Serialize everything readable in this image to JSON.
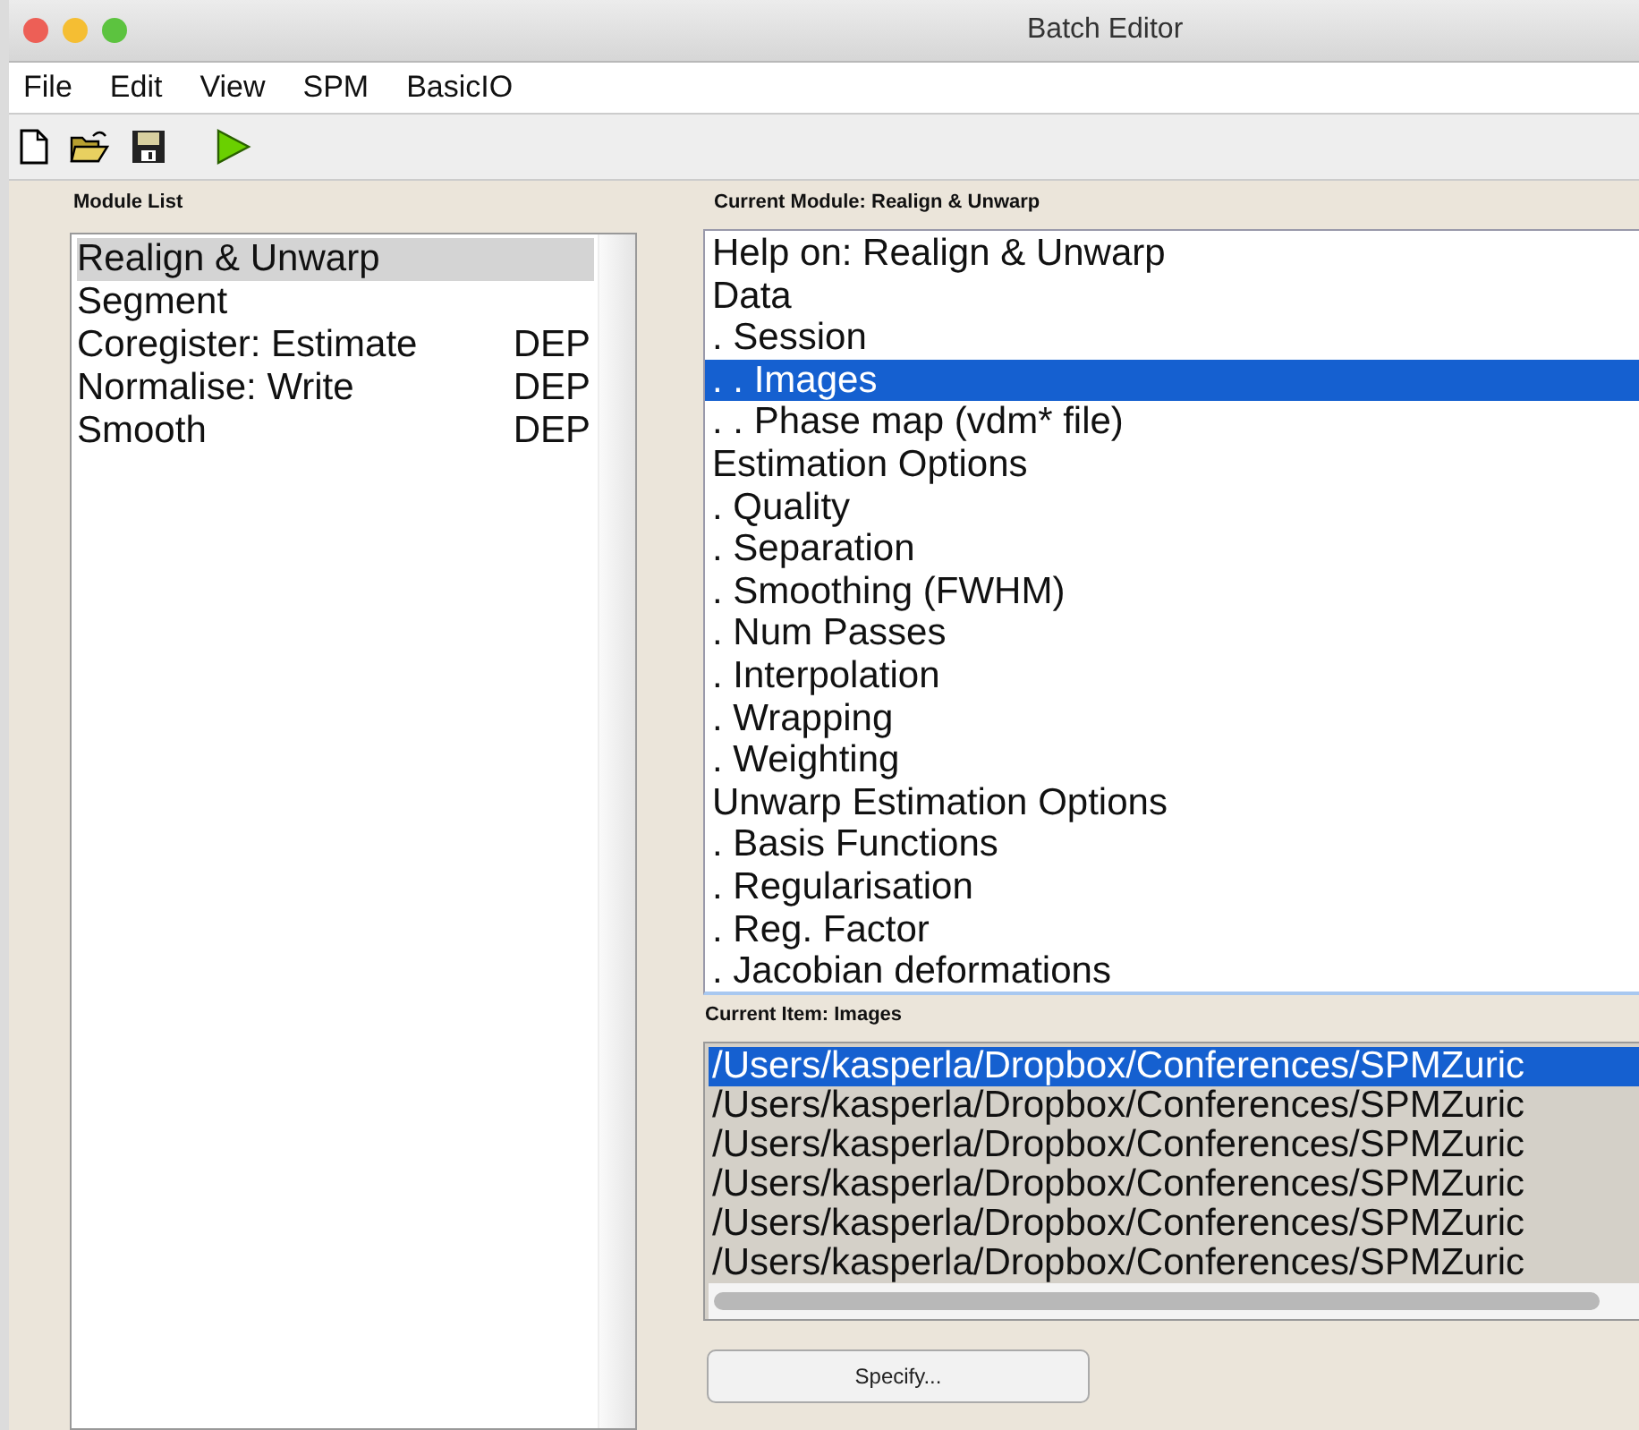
{
  "window": {
    "title": "Batch Editor"
  },
  "menu": [
    "File",
    "Edit",
    "View",
    "SPM",
    "BasicIO"
  ],
  "module_list": {
    "label": "Module List",
    "items": [
      {
        "name": "Realign & Unwarp",
        "selected": true
      },
      {
        "name": "Segment",
        "selected": false
      },
      {
        "name": "Coregister: Estimate",
        "tag": "DEP",
        "selected": false
      },
      {
        "name": "Normalise: Write",
        "tag": "DEP",
        "selected": false
      },
      {
        "name": "Smooth",
        "tag": "DEP",
        "selected": false
      }
    ]
  },
  "current_module": {
    "label": "Current Module: Realign & Unwarp",
    "items": [
      {
        "text": "Help on: Realign & Unwarp",
        "selected": false
      },
      {
        "text": "Data",
        "selected": false
      },
      {
        "text": ". Session",
        "selected": false
      },
      {
        "text": ". . Images",
        "selected": true
      },
      {
        "text": ". . Phase map (vdm* file)",
        "selected": false
      },
      {
        "text": "Estimation Options",
        "selected": false
      },
      {
        "text": ". Quality",
        "selected": false
      },
      {
        "text": ". Separation",
        "selected": false
      },
      {
        "text": ". Smoothing (FWHM)",
        "selected": false
      },
      {
        "text": ". Num Passes",
        "selected": false
      },
      {
        "text": ". Interpolation",
        "selected": false
      },
      {
        "text": ". Wrapping",
        "selected": false
      },
      {
        "text": ". Weighting",
        "selected": false
      },
      {
        "text": "Unwarp Estimation Options",
        "selected": false
      },
      {
        "text": ". Basis Functions",
        "selected": false
      },
      {
        "text": ". Regularisation",
        "selected": false
      },
      {
        "text": ". Reg. Factor",
        "selected": false
      },
      {
        "text": ". Jacobian deformations",
        "selected": false
      }
    ]
  },
  "current_item": {
    "label": "Current Item: Images",
    "files": [
      {
        "text": "/Users/kasperla/Dropbox/Conferences/SPMZuric",
        "selected": true
      },
      {
        "text": "/Users/kasperla/Dropbox/Conferences/SPMZuric",
        "selected": false
      },
      {
        "text": "/Users/kasperla/Dropbox/Conferences/SPMZuric",
        "selected": false
      },
      {
        "text": "/Users/kasperla/Dropbox/Conferences/SPMZuric",
        "selected": false
      },
      {
        "text": "/Users/kasperla/Dropbox/Conferences/SPMZuric",
        "selected": false
      },
      {
        "text": "/Users/kasperla/Dropbox/Conferences/SPMZuric",
        "selected": false
      }
    ]
  },
  "buttons": [
    "Specify..."
  ]
}
